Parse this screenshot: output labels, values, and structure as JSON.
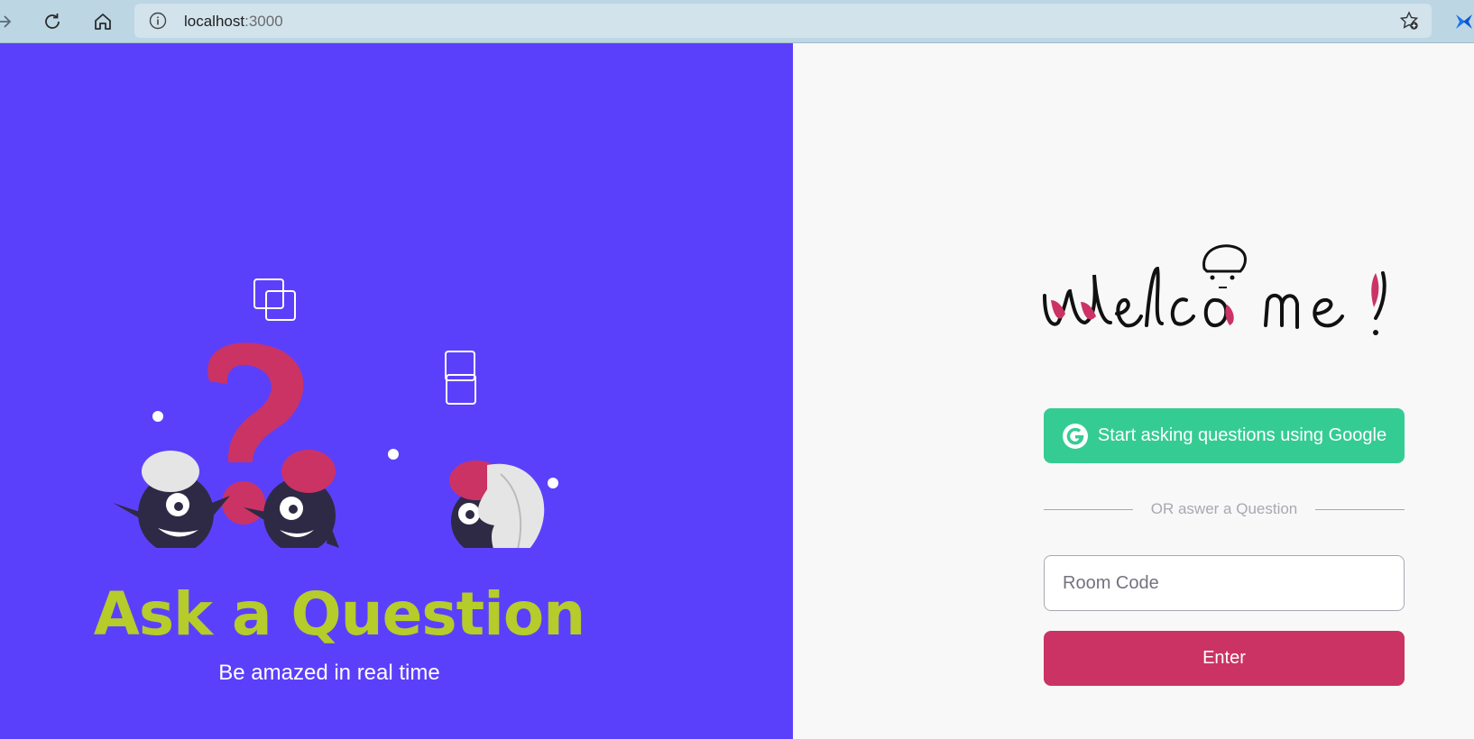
{
  "browser": {
    "url_host": "localhost",
    "url_port": ":3000"
  },
  "hero": {
    "title": "Ask a Question",
    "subtitle": "Be amazed in real time"
  },
  "panel": {
    "logo_alt": "Welcome!",
    "google_button_label": "Start asking questions using Google",
    "divider_text": "OR aswer a Question",
    "room_input_placeholder": "Room Code",
    "room_input_value": "",
    "enter_button_label": "Enter"
  },
  "colors": {
    "hero_bg": "#5b40fb",
    "title": "#b5cc2a",
    "google": "#35cc94",
    "enter": "#cb3364",
    "accent_pink": "#cb3364"
  },
  "icons": {
    "back": "arrow-right-icon",
    "reload": "reload-icon",
    "home": "home-icon",
    "info": "info-icon",
    "favorite": "star-add-icon",
    "extension": "extension-icon",
    "google": "google-icon"
  }
}
